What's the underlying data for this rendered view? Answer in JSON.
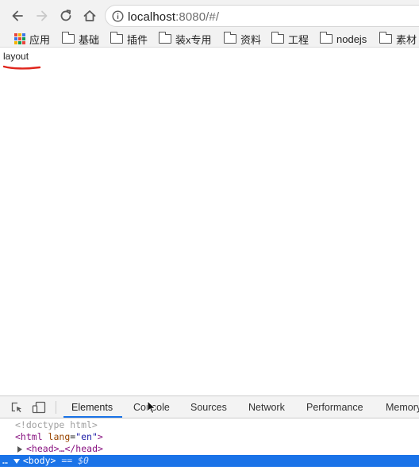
{
  "browser": {
    "url_host": "localhost",
    "url_rest": ":8080/#/"
  },
  "bookmarks": [
    {
      "label": "应用",
      "icon": "apps-grid-icon"
    },
    {
      "label": "基础",
      "icon": "folder-icon"
    },
    {
      "label": "插件",
      "icon": "folder-icon"
    },
    {
      "label": "装x专用",
      "icon": "folder-icon"
    },
    {
      "label": "资料",
      "icon": "folder-icon"
    },
    {
      "label": "工程",
      "icon": "folder-icon"
    },
    {
      "label": "nodejs",
      "icon": "folder-icon"
    },
    {
      "label": "素材",
      "icon": "folder-icon"
    }
  ],
  "page": {
    "layout_text": "layout"
  },
  "devtools": {
    "tabs": [
      "Elements",
      "Console",
      "Sources",
      "Network",
      "Performance",
      "Memory"
    ],
    "active_tab": "Elements",
    "dom": {
      "doctype": "<!doctype html>",
      "html_open": "<html",
      "html_attr": " lang",
      "html_eq": "=",
      "html_val": "\"en\"",
      "html_close": ">",
      "head": "<head>…</head>",
      "body": "<body>",
      "body_ref": "== $0",
      "ellipsis": "…"
    }
  },
  "colors": {
    "accent": "#1a73e8",
    "annotation": "#e0251c"
  }
}
